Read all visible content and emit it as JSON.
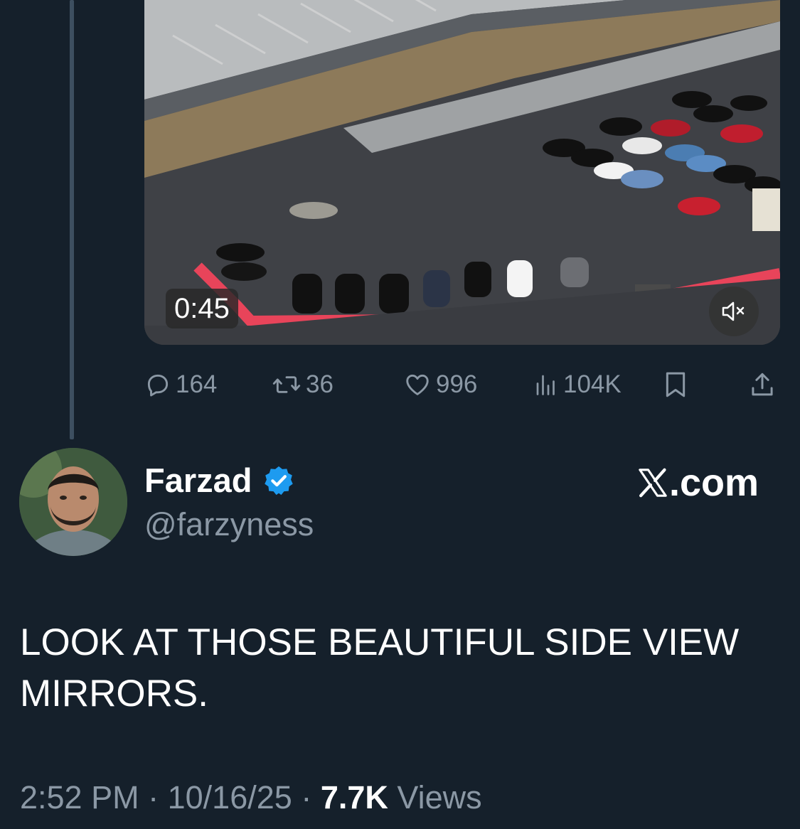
{
  "video": {
    "timestamp": "0:45",
    "mute_icon": "speaker-muted-icon"
  },
  "actions": {
    "replies": "164",
    "reposts": "36",
    "likes": "996",
    "views": "104K",
    "icons": [
      "reply-icon",
      "repost-icon",
      "like-icon",
      "views-icon",
      "bookmark-icon",
      "share-icon"
    ]
  },
  "author": {
    "name": "Farzad",
    "handle": "@farzyness",
    "verified": true,
    "verified_color": "#1d9bf0"
  },
  "source": {
    "label": ".com",
    "logo": "x-logo-icon"
  },
  "tweet": {
    "text": "LOOK AT THOSE BEAUTIFUL SIDE VIEW MIRRORS."
  },
  "meta": {
    "time": "2:52 PM",
    "date": "10/16/25",
    "views_count": "7.7K",
    "views_label": "Views",
    "separator": "·"
  },
  "colors": {
    "background": "#15202b",
    "muted_text": "#8b98a5",
    "curb": "#e8445a"
  }
}
